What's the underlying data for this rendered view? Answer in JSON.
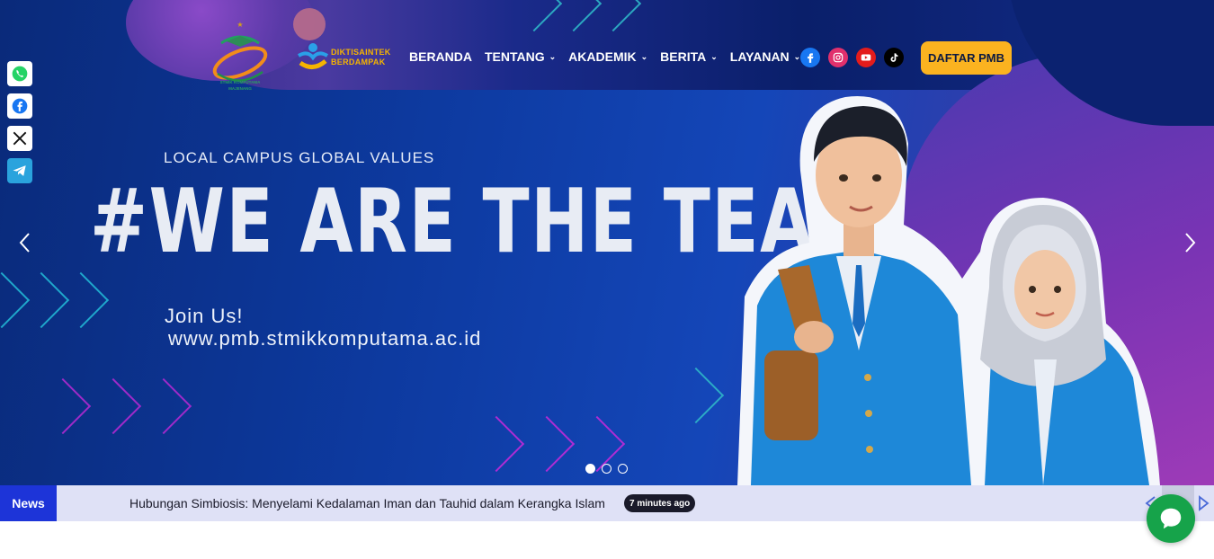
{
  "header": {
    "logo_text": "STMIK KOMPUTAMA MAJENANG",
    "dikti_line1": "DIKTISAINTEK",
    "dikti_line2": "BERDAMPAK",
    "nav": [
      {
        "label": "BERANDA",
        "caret": ""
      },
      {
        "label": "TENTANG",
        "caret": "⌄"
      },
      {
        "label": "AKADEMIK",
        "caret": "⌄"
      },
      {
        "label": "BERITA",
        "caret": "⌄"
      },
      {
        "label": "LAYANAN",
        "caret": "⌄"
      }
    ],
    "socials": [
      "facebook-icon",
      "instagram-icon",
      "youtube-icon",
      "tiktok-icon"
    ],
    "cta_label": "DAFTAR PMB"
  },
  "share_bar": [
    "whatsapp-icon",
    "facebook-icon",
    "x-icon",
    "telegram-icon"
  ],
  "hero": {
    "tagline": "LOCAL CAMPUS GLOBAL VALUES",
    "headline": "#WE ARE THE TEAM",
    "join": "Join Us!",
    "url": "www.pmb.stmikkomputama.ac.id",
    "slides": 3,
    "active_slide": 1
  },
  "news": {
    "label": "News",
    "headline": "Hubungan Simbiosis: Menyelami Kedalaman Iman dan Tauhid dalam Kerangka Islam",
    "time": "7 minutes ago"
  },
  "colors": {
    "accent": "#fbb320",
    "news_label": "#1d34d8",
    "ticker_bg": "#dfe1f6",
    "chat": "#16a34a"
  }
}
